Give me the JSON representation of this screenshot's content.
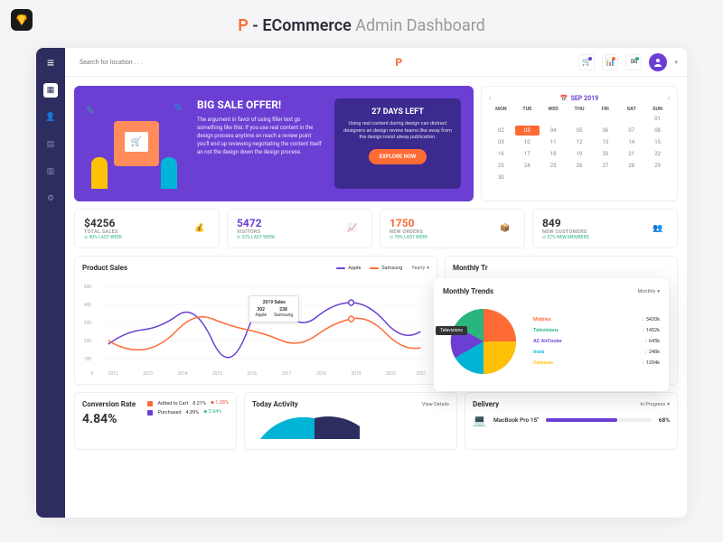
{
  "page_title": {
    "brand": "P",
    "dash_label": "- ECommerce",
    "light": "Admin Dashboard"
  },
  "search": {
    "placeholder": "Search for location . . ."
  },
  "hero": {
    "title": "BIG SALE OFFER!",
    "body": "The argument in favor of using filler text go something like this: If you use real content in the design process anytime on reach a review point you'll end up reviewing negotiating the content itself an not the design down the design process.",
    "cta_title": "27 DAYS LEFT",
    "cta_body": "Using real content during design can distract designers an design review teams like away from the design insist alway publication.",
    "cta_button": "EXPLORE NOW"
  },
  "calendar": {
    "month": "SEP 2019",
    "dow": [
      "MON",
      "TUE",
      "WED",
      "THU",
      "FRI",
      "SAT",
      "SUN"
    ],
    "days": [
      " ",
      " ",
      " ",
      " ",
      " ",
      " ",
      "01",
      "02",
      "03",
      "04",
      "05",
      "06",
      "07",
      "08",
      "09",
      "10",
      "11",
      "12",
      "13",
      "14",
      "15",
      "16",
      "17",
      "18",
      "19",
      "20",
      "21",
      "22",
      "23",
      "24",
      "25",
      "26",
      "27",
      "28",
      "29",
      "30"
    ]
  },
  "stats": [
    {
      "value": "$4256",
      "label": "TOTAL SALES",
      "change": "40% LAST WEEK",
      "color": "#333"
    },
    {
      "value": "5472",
      "label": "VISITORS",
      "change": "32% LAST WEEK",
      "color": "#6b3fd4"
    },
    {
      "value": "1750",
      "label": "NEW ORDERS",
      "change": "70% LAST WEEK",
      "color": "#ff6b35"
    },
    {
      "value": "849",
      "label": "NEW CUSTOMERS",
      "change": "57% NEW MEMBERS",
      "color": "#333"
    }
  ],
  "product_sales": {
    "title": "Product Sales",
    "legend": [
      {
        "name": "Apple",
        "color": "#6b3fd4"
      },
      {
        "name": "Samsung",
        "color": "#ff6b35"
      }
    ],
    "period": "Yearly",
    "tooltip": {
      "title": "2019 Sales",
      "a_val": "302",
      "a_name": "Apple",
      "b_val": "238",
      "b_name": "Samsung"
    }
  },
  "monthly_trends": {
    "title": "Monthly Trends",
    "period": "Monthly",
    "tooltip": "Televisions",
    "legend": [
      {
        "name": "Mobiles",
        "value": "5420k",
        "color": "#ff6b35"
      },
      {
        "name": "Televisions",
        "value": "1452k",
        "color": "#2ab57d"
      },
      {
        "name": "AC AirCooler",
        "value": "645k",
        "color": "#6b3fd4"
      },
      {
        "name": "Irons",
        "value": "248k",
        "color": "#00b4d8"
      },
      {
        "name": "Cameras",
        "value": "1204k",
        "color": "#ffc107"
      }
    ]
  },
  "conversion": {
    "title": "Conversion Rate",
    "value": "4.84%",
    "rows": [
      {
        "label": "Added to Cart",
        "val": "8.21%",
        "delta": "1.28%",
        "deltaColor": "#e74c3c",
        "color": "#ff6b35"
      },
      {
        "label": "Purchased",
        "val": "4.89%",
        "delta": "3.84%",
        "deltaColor": "#2ab57d",
        "color": "#6b3fd4"
      }
    ]
  },
  "today_activity": {
    "title": "Today Activity",
    "link": "View Details"
  },
  "delivery": {
    "title": "Delivery",
    "status": "In Progress",
    "item": "MacBook Pro 15\"",
    "pct": "68%",
    "pct_val": 68
  },
  "chart_data": [
    {
      "type": "line",
      "title": "Product Sales",
      "x": [
        2012,
        2013,
        2014,
        2015,
        2016,
        2017,
        2018,
        2019,
        2020,
        2021
      ],
      "ylim": [
        0,
        500
      ],
      "yticks": [
        0,
        100,
        200,
        300,
        400,
        500
      ],
      "series": [
        {
          "name": "Apple",
          "color": "#6b3fd4",
          "values": [
            180,
            260,
            340,
            200,
            250,
            380,
            330,
            410,
            302,
            250
          ]
        },
        {
          "name": "Samsung",
          "color": "#ff6b35",
          "values": [
            200,
            150,
            260,
            320,
            260,
            200,
            230,
            320,
            238,
            160
          ]
        }
      ]
    },
    {
      "type": "pie",
      "title": "Monthly Trends",
      "series": [
        {
          "name": "Mobiles",
          "value": 5420,
          "color": "#ff6b35"
        },
        {
          "name": "Televisions",
          "value": 1452,
          "color": "#2ab57d"
        },
        {
          "name": "AC AirCooler",
          "value": 645,
          "color": "#6b3fd4"
        },
        {
          "name": "Irons",
          "value": 248,
          "color": "#00b4d8"
        },
        {
          "name": "Cameras",
          "value": 1204,
          "color": "#ffc107"
        }
      ]
    }
  ]
}
